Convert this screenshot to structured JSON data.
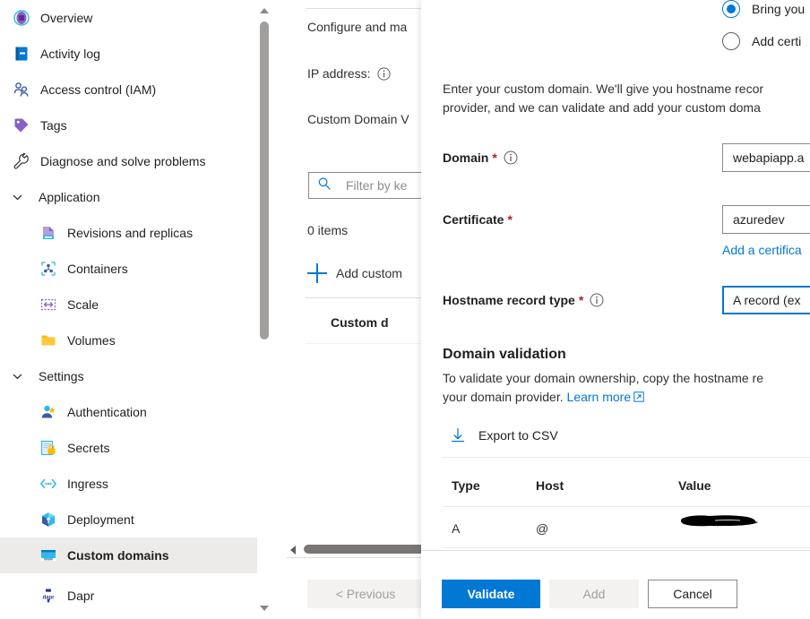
{
  "sidebar": {
    "items": [
      {
        "label": "Overview",
        "icon": "overview-icon",
        "level": 0,
        "type": "link",
        "selected": false
      },
      {
        "label": "Activity log",
        "icon": "activity-log-icon",
        "level": 0,
        "type": "link",
        "selected": false
      },
      {
        "label": "Access control (IAM)",
        "icon": "access-control-icon",
        "level": 0,
        "type": "link",
        "selected": false
      },
      {
        "label": "Tags",
        "icon": "tag-icon",
        "level": 0,
        "type": "link",
        "selected": false
      },
      {
        "label": "Diagnose and solve problems",
        "icon": "wrench-icon",
        "level": 0,
        "type": "link",
        "selected": false
      },
      {
        "label": "Application",
        "icon": "chevron-down-icon",
        "level": 0,
        "type": "group",
        "selected": false
      },
      {
        "label": "Revisions and replicas",
        "icon": "revisions-icon",
        "level": 1,
        "type": "link",
        "selected": false
      },
      {
        "label": "Containers",
        "icon": "containers-icon",
        "level": 1,
        "type": "link",
        "selected": false
      },
      {
        "label": "Scale",
        "icon": "scale-icon",
        "level": 1,
        "type": "link",
        "selected": false
      },
      {
        "label": "Volumes",
        "icon": "volumes-icon",
        "level": 1,
        "type": "link",
        "selected": false
      },
      {
        "label": "Settings",
        "icon": "chevron-down-icon",
        "level": 0,
        "type": "group",
        "selected": false
      },
      {
        "label": "Authentication",
        "icon": "authentication-icon",
        "level": 1,
        "type": "link",
        "selected": false
      },
      {
        "label": "Secrets",
        "icon": "secrets-icon",
        "level": 1,
        "type": "link",
        "selected": false
      },
      {
        "label": "Ingress",
        "icon": "ingress-icon",
        "level": 1,
        "type": "link",
        "selected": false
      },
      {
        "label": "Deployment",
        "icon": "deployment-icon",
        "level": 1,
        "type": "link",
        "selected": false
      },
      {
        "label": "Custom domains",
        "icon": "custom-domains-icon",
        "level": 1,
        "type": "link",
        "selected": true
      },
      {
        "label": "Dapr",
        "icon": "dapr-icon",
        "level": 1,
        "type": "link",
        "selected": false
      }
    ]
  },
  "middle": {
    "description": "Configure and ma",
    "ip_address_label": "IP address:",
    "custom_domain_label": "Custom Domain V",
    "filter_placeholder": "Filter by ke",
    "items_count": "0 items",
    "add_custom_domain": "Add custom",
    "column_header": "Custom d",
    "previous_button": "< Previous"
  },
  "flyout": {
    "radio_options": [
      {
        "label": "Bring you",
        "selected": true
      },
      {
        "label": "Add certi",
        "selected": false
      }
    ],
    "intro_line1": "Enter your custom domain. We'll give you hostname recor",
    "intro_line2": "provider, and we can validate and add your custom doma",
    "fields": {
      "domain": {
        "label": "Domain",
        "required": "*",
        "value": "webapiapp.a",
        "info": "info-icon"
      },
      "certificate": {
        "label": "Certificate",
        "required": "*",
        "value": "azuredev",
        "add_link": "Add a certifica"
      },
      "hostname_record_type": {
        "label": "Hostname record type",
        "required": "*",
        "value": "A record (ex",
        "info": "info-icon"
      }
    },
    "domain_validation": {
      "heading": "Domain validation",
      "body_line1": "To validate your domain ownership, copy the hostname re",
      "body_line2_prefix": "your domain provider. ",
      "body_line2_link": "Learn more",
      "export_label": "Export to CSV",
      "table": {
        "columns": [
          "Type",
          "Host",
          "Value"
        ],
        "rows": [
          {
            "type": "A",
            "host": "@",
            "value": ""
          }
        ]
      }
    },
    "buttons": {
      "validate": "Validate",
      "add": "Add",
      "cancel": "Cancel"
    }
  },
  "colors": {
    "accent": "#0078d4",
    "selected_row": "#edebe9",
    "required": "#a4262c",
    "disabled_text": "#a19f9d"
  }
}
